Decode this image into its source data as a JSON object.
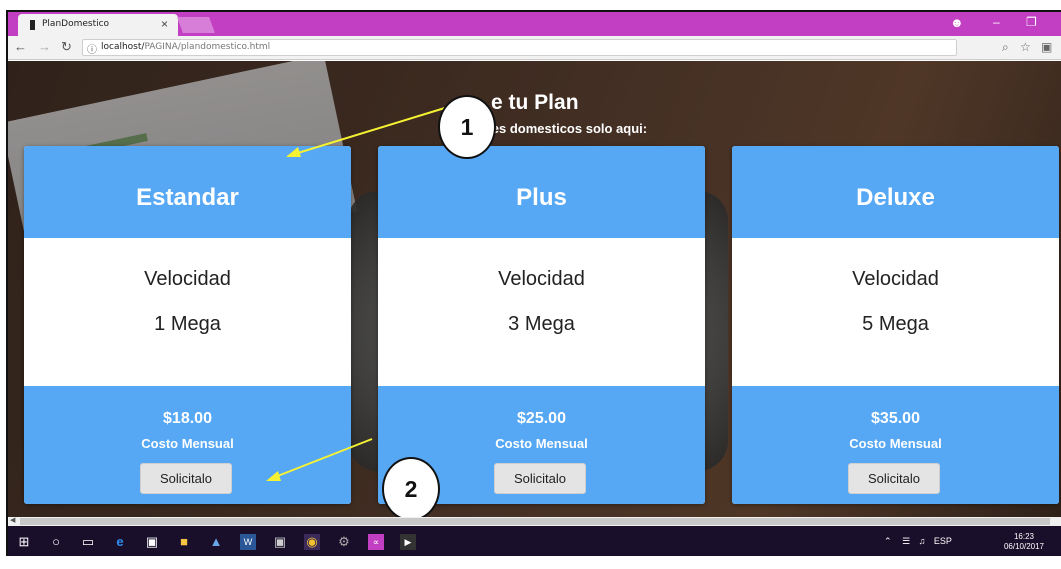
{
  "browser": {
    "tab_title": "PlanDomestico",
    "tab_close": "×",
    "url_host": "localhost/",
    "url_path": "PAGINA/plandomestico.html"
  },
  "page": {
    "title": "e tu Plan",
    "subtitle": "lanes domesticos solo aqui:"
  },
  "plans": [
    {
      "name": "Estandar",
      "speed_label": "Velocidad",
      "speed": "1 Mega",
      "price": "$18.00",
      "period": "Costo Mensual",
      "button": "Solicitalo"
    },
    {
      "name": "Plus",
      "speed_label": "Velocidad",
      "speed": "3 Mega",
      "price": "$25.00",
      "period": "Costo Mensual",
      "button": "Solicitalo"
    },
    {
      "name": "Deluxe",
      "speed_label": "Velocidad",
      "speed": "5 Mega",
      "price": "$35.00",
      "period": "Costo Mensual",
      "button": "Solicitalo"
    }
  ],
  "annotations": {
    "callout_1": "1",
    "callout_2": "2"
  },
  "taskbar": {
    "language": "ESP",
    "time": "16:23",
    "date": "06/10/2017"
  },
  "colors": {
    "card_accent": "#57a8f4",
    "titlebar": "#c23ec3",
    "taskbar": "#1a0f2b",
    "arrow": "#f5f233"
  }
}
